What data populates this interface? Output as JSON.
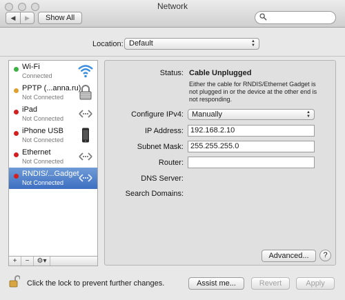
{
  "window": {
    "title": "Network"
  },
  "toolbar": {
    "back_glyph": "◀",
    "forward_glyph": "▶",
    "show_all_label": "Show All",
    "search_placeholder": ""
  },
  "location": {
    "label": "Location:",
    "value": "Default"
  },
  "services": [
    {
      "name": "Wi-Fi",
      "status": "Connected",
      "dot_color": "#3cb043",
      "icon": "wifi-icon"
    },
    {
      "name": "PPTP (...anna.ru)",
      "status": "Not Connected",
      "dot_color": "#e0a030",
      "icon": "vpn-lock-icon"
    },
    {
      "name": "iPad",
      "status": "Not Connected",
      "dot_color": "#d22020",
      "icon": "ethernet-arrows-icon"
    },
    {
      "name": "iPhone USB",
      "status": "Not Connected",
      "dot_color": "#d22020",
      "icon": "iphone-icon"
    },
    {
      "name": "Ethernet",
      "status": "Not Connected",
      "dot_color": "#d22020",
      "icon": "ethernet-arrows-icon"
    },
    {
      "name": "RNDIS/...Gadget",
      "status": "Not Connected",
      "dot_color": "#d22020",
      "icon": "ethernet-arrows-icon"
    }
  ],
  "selected_service_index": 5,
  "sidebar_tools": {
    "add": "+",
    "remove": "−",
    "gear": "⚙▾"
  },
  "detail": {
    "status_label": "Status:",
    "status_value": "Cable Unplugged",
    "status_note": "Either the cable for RNDIS/Ethernet Gadget is not plugged in or the device at the other end is not responding.",
    "configure_label": "Configure IPv4:",
    "configure_value": "Manually",
    "ip_label": "IP Address:",
    "ip_value": "192.168.2.10",
    "subnet_label": "Subnet Mask:",
    "subnet_value": "255.255.255.0",
    "router_label": "Router:",
    "router_value": "",
    "dns_label": "DNS Server:",
    "search_domains_label": "Search Domains:",
    "advanced_label": "Advanced...",
    "help_label": "?"
  },
  "footer": {
    "lock_text": "Click the lock to prevent further changes.",
    "assist_label": "Assist me...",
    "revert_label": "Revert",
    "apply_label": "Apply"
  },
  "colors": {
    "selection": "#3d6fc2",
    "connected": "#3cb043",
    "pending": "#e0a030",
    "disconnected": "#d22020"
  }
}
